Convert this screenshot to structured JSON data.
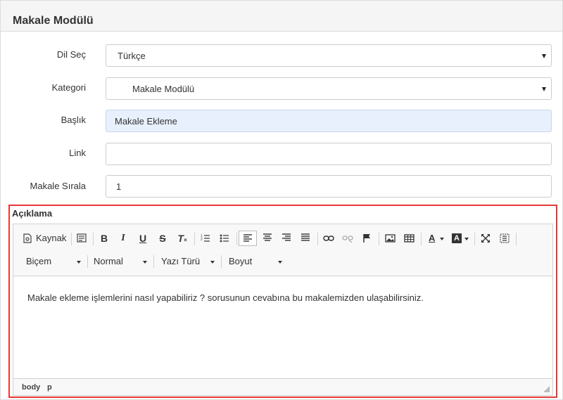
{
  "panel": {
    "title": "Makale Modülü"
  },
  "form": {
    "dil_sec": {
      "label": "Dil Seç",
      "value": "Türkçe"
    },
    "kategori": {
      "label": "Kategori",
      "value": "Makale Modülü"
    },
    "baslik": {
      "label": "Başlık",
      "value": "Makale Ekleme"
    },
    "link": {
      "label": "Link",
      "value": ""
    },
    "sira": {
      "label": "Makale Sırala",
      "value": "1"
    }
  },
  "editor": {
    "label": "Açıklama",
    "toolbar": {
      "source_label": "Kaynak",
      "bold": "B",
      "italic": "I",
      "underline": "U",
      "strike": "S",
      "remove_format": "T",
      "text_color": "A",
      "bg_color": "A"
    },
    "combos": {
      "style": "Biçem",
      "format": "Normal",
      "font": "Yazı Türü",
      "size": "Boyut"
    },
    "content": "Makale ekleme işlemlerini nasıl yapabiliriz ? sorusunun cevabına bu makalemizden ulaşabilirsiniz.",
    "path": [
      "body",
      "p"
    ]
  }
}
